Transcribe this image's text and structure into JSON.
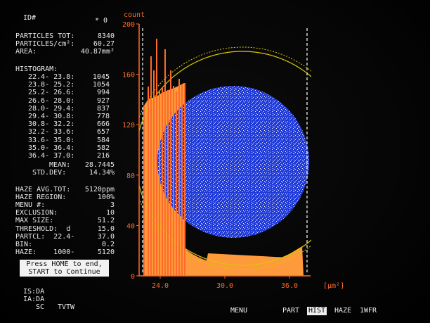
{
  "header": {
    "id_label": "ID#",
    "id_value": "* 0"
  },
  "summary": {
    "particles_tot_label": "PARTICLES TOT:",
    "particles_tot_value": "8340",
    "particles_cm2_label": "PARTICLES/cm²:",
    "particles_cm2_value": "60.27",
    "area_label": "AREA:",
    "area_value": "40.87mm²"
  },
  "histogram": {
    "title": "HISTOGRAM:",
    "rows": [
      {
        "range": "22.4- 23.8:",
        "value": "1045"
      },
      {
        "range": "23.8- 25.2:",
        "value": "1054"
      },
      {
        "range": "25.2- 26.6:",
        "value": "994"
      },
      {
        "range": "26.6- 28.0:",
        "value": "927"
      },
      {
        "range": "28.0- 29.4:",
        "value": "837"
      },
      {
        "range": "29.4- 30.8:",
        "value": "778"
      },
      {
        "range": "30.8- 32.2:",
        "value": "666"
      },
      {
        "range": "32.2- 33.6:",
        "value": "657"
      },
      {
        "range": "33.6- 35.0:",
        "value": "584"
      },
      {
        "range": "35.0- 36.4:",
        "value": "582"
      },
      {
        "range": "36.4- 37.0:",
        "value": "216"
      }
    ],
    "mean_label": "MEAN:",
    "mean_value": "28.7445",
    "std_label": "STD.DEV:",
    "std_value": "14.34%"
  },
  "settings": [
    {
      "label": "HAZE AVG.TOT:",
      "value": "5120ppm"
    },
    {
      "label": "HAZE REGION:",
      "value": "100%"
    },
    {
      "label": "MENU #:",
      "value": "3"
    },
    {
      "label": "EXCLUSION:",
      "value": "10"
    },
    {
      "label": "MAX SIZE:",
      "value": "51.2"
    },
    {
      "label": "THRESHOLD:  d",
      "value": "15.0"
    },
    {
      "label": "PARTCL:  22.4-",
      "value": "37.0"
    },
    {
      "label": "BIN:",
      "value": "0.2"
    },
    {
      "label": "HAZE:    1000-",
      "value": "5120"
    }
  ],
  "message": {
    "line1": "Press HOME to end,",
    "line2": "START to Continue"
  },
  "status": {
    "is": "IS:DA",
    "ia": "IA:DA",
    "sc": "SC",
    "tvtw": "TVTW"
  },
  "menu": {
    "items": [
      "MENU",
      "PART",
      "HIST",
      "HAZE",
      "1WFR"
    ],
    "selected": "HIST"
  },
  "chart_data": {
    "type": "bar",
    "ylabel": "count",
    "xlabel": "[µm²]",
    "ylim": [
      0,
      200
    ],
    "yticks": [
      "200",
      "160",
      "120",
      "80",
      "40",
      "0"
    ],
    "xticks": [
      "24.0",
      "30.0",
      "36.0"
    ],
    "bar_color": "#ff6a2a",
    "area_color": "#ff9a3c",
    "wafer_color": "#1f3ad6",
    "grid": false
  }
}
